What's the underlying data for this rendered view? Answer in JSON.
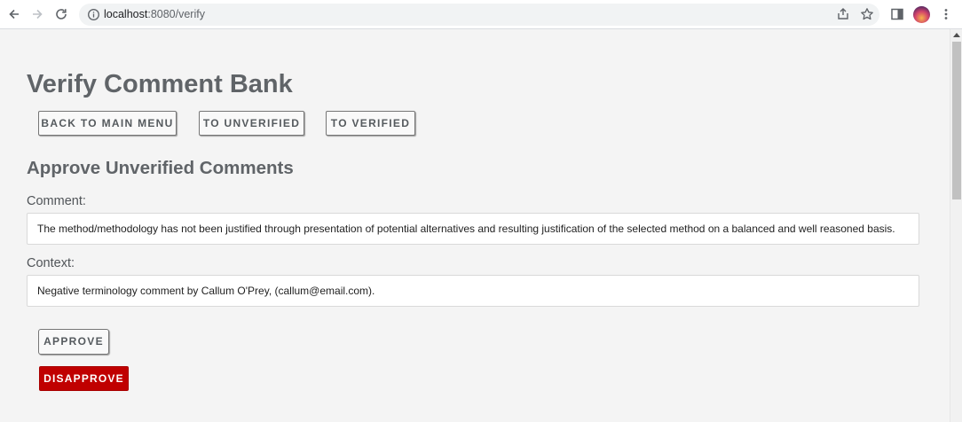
{
  "browser": {
    "url_host": "localhost",
    "url_rest": ":8080/verify",
    "icons": [
      "back-arrow-icon",
      "forward-arrow-icon",
      "reload-icon",
      "info-icon",
      "share-icon",
      "star-icon",
      "side-panel-icon",
      "avatar",
      "more-vert-icon"
    ]
  },
  "page": {
    "title": "Verify Comment Bank",
    "nav_buttons": {
      "back": "BACK TO MAIN MENU",
      "unverified": "TO UNVERIFIED",
      "verified": "TO VERIFIED"
    },
    "section_title": "Approve Unverified Comments",
    "comment_label": "Comment:",
    "comment_value": "The method/methodology has not been justified through presentation of potential alternatives and resulting justification of the selected method on a balanced and well reasoned basis.",
    "context_label": "Context:",
    "context_value": "Negative terminology comment by Callum O'Prey, (callum@email.com).",
    "approve_label": "APPROVE",
    "disapprove_label": "DISAPPROVE"
  },
  "colors": {
    "disapprove": "#c00000",
    "heading": "#606468",
    "background": "#f4f4f4"
  }
}
